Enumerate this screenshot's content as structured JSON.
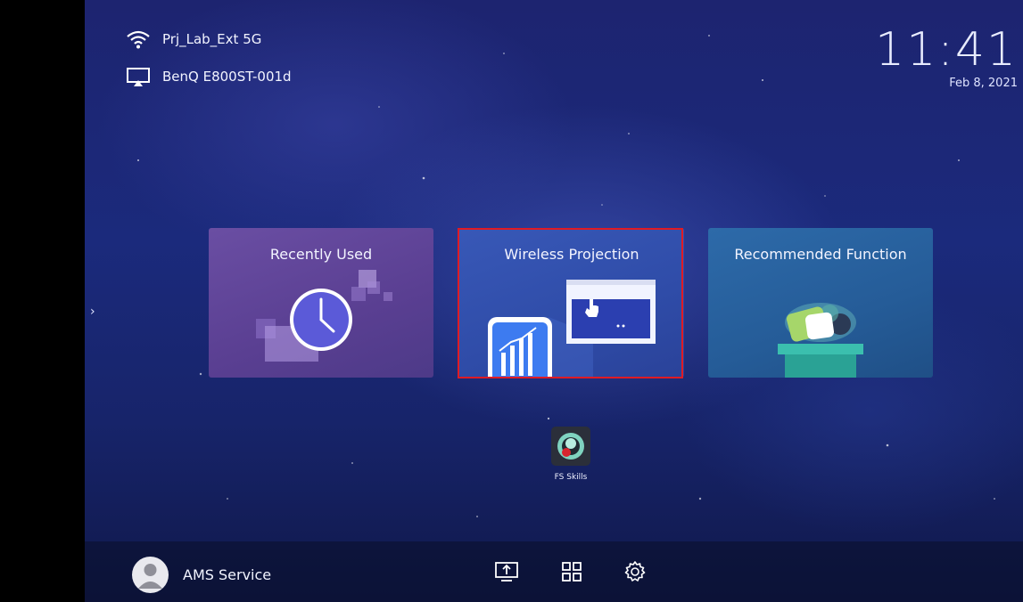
{
  "status": {
    "wifi_name": "Prj_Lab_Ext 5G",
    "device_name": "BenQ E800ST-001d"
  },
  "clock": {
    "time": "11:41",
    "date": "Feb 8, 2021"
  },
  "side_panel": {
    "arrow_icon": "chevron-right-icon"
  },
  "tiles": [
    {
      "label": "Recently Used",
      "icon": "clock-icon",
      "color": "#5f4598"
    },
    {
      "label": "Wireless Projection",
      "icon": "phone-to-screen-icon",
      "color": "#3452b0",
      "selected": true
    },
    {
      "label": "Recommended Function",
      "icon": "app-box-icon",
      "color": "#2a649f"
    }
  ],
  "highlight_color": "#e01b24",
  "apps": [
    {
      "label": "FS Skills",
      "icon": "fs-skills-app-icon"
    }
  ],
  "bottom_bar": {
    "user_name": "AMS Service",
    "buttons": [
      "screen-share-icon",
      "apps-grid-icon",
      "gear-icon"
    ]
  }
}
